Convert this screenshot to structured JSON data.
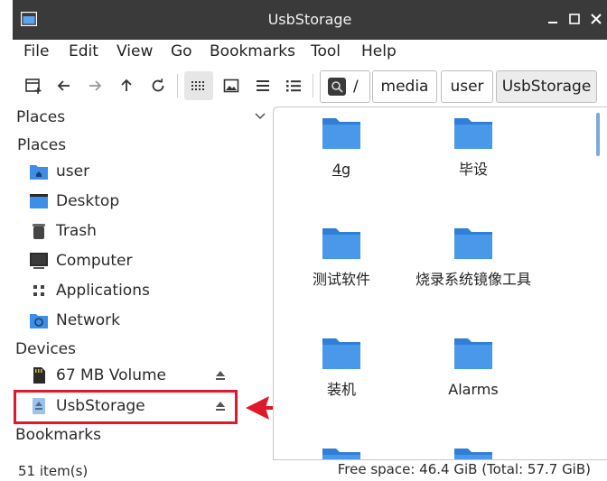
{
  "window": {
    "title": "UsbStorage"
  },
  "menu": [
    "File",
    "Edit",
    "View",
    "Go",
    "Bookmarks",
    "Tool",
    "Help"
  ],
  "breadcrumb": {
    "root": "/",
    "parts": [
      "media",
      "user",
      "UsbStorage"
    ]
  },
  "sidebar": {
    "panel_title": "Places",
    "places_header": "Places",
    "places": [
      "user",
      "Desktop",
      "Trash",
      "Computer",
      "Applications",
      "Network"
    ],
    "devices_header": "Devices",
    "devices": [
      "67 MB Volume",
      "UsbStorage"
    ],
    "bookmarks_header": "Bookmarks"
  },
  "files": [
    "4g",
    "毕设",
    "测试软件",
    "烧录系统镜像工具",
    "装机",
    "Alarms"
  ],
  "status": {
    "count": "51 item(s)",
    "free_space": "Free space: 46.4 GiB (Total: 57.7 GiB)"
  },
  "colors": {
    "titlebar": "#3a3a3a",
    "folder": "#3d8ee6",
    "highlight": "#e0182c"
  }
}
